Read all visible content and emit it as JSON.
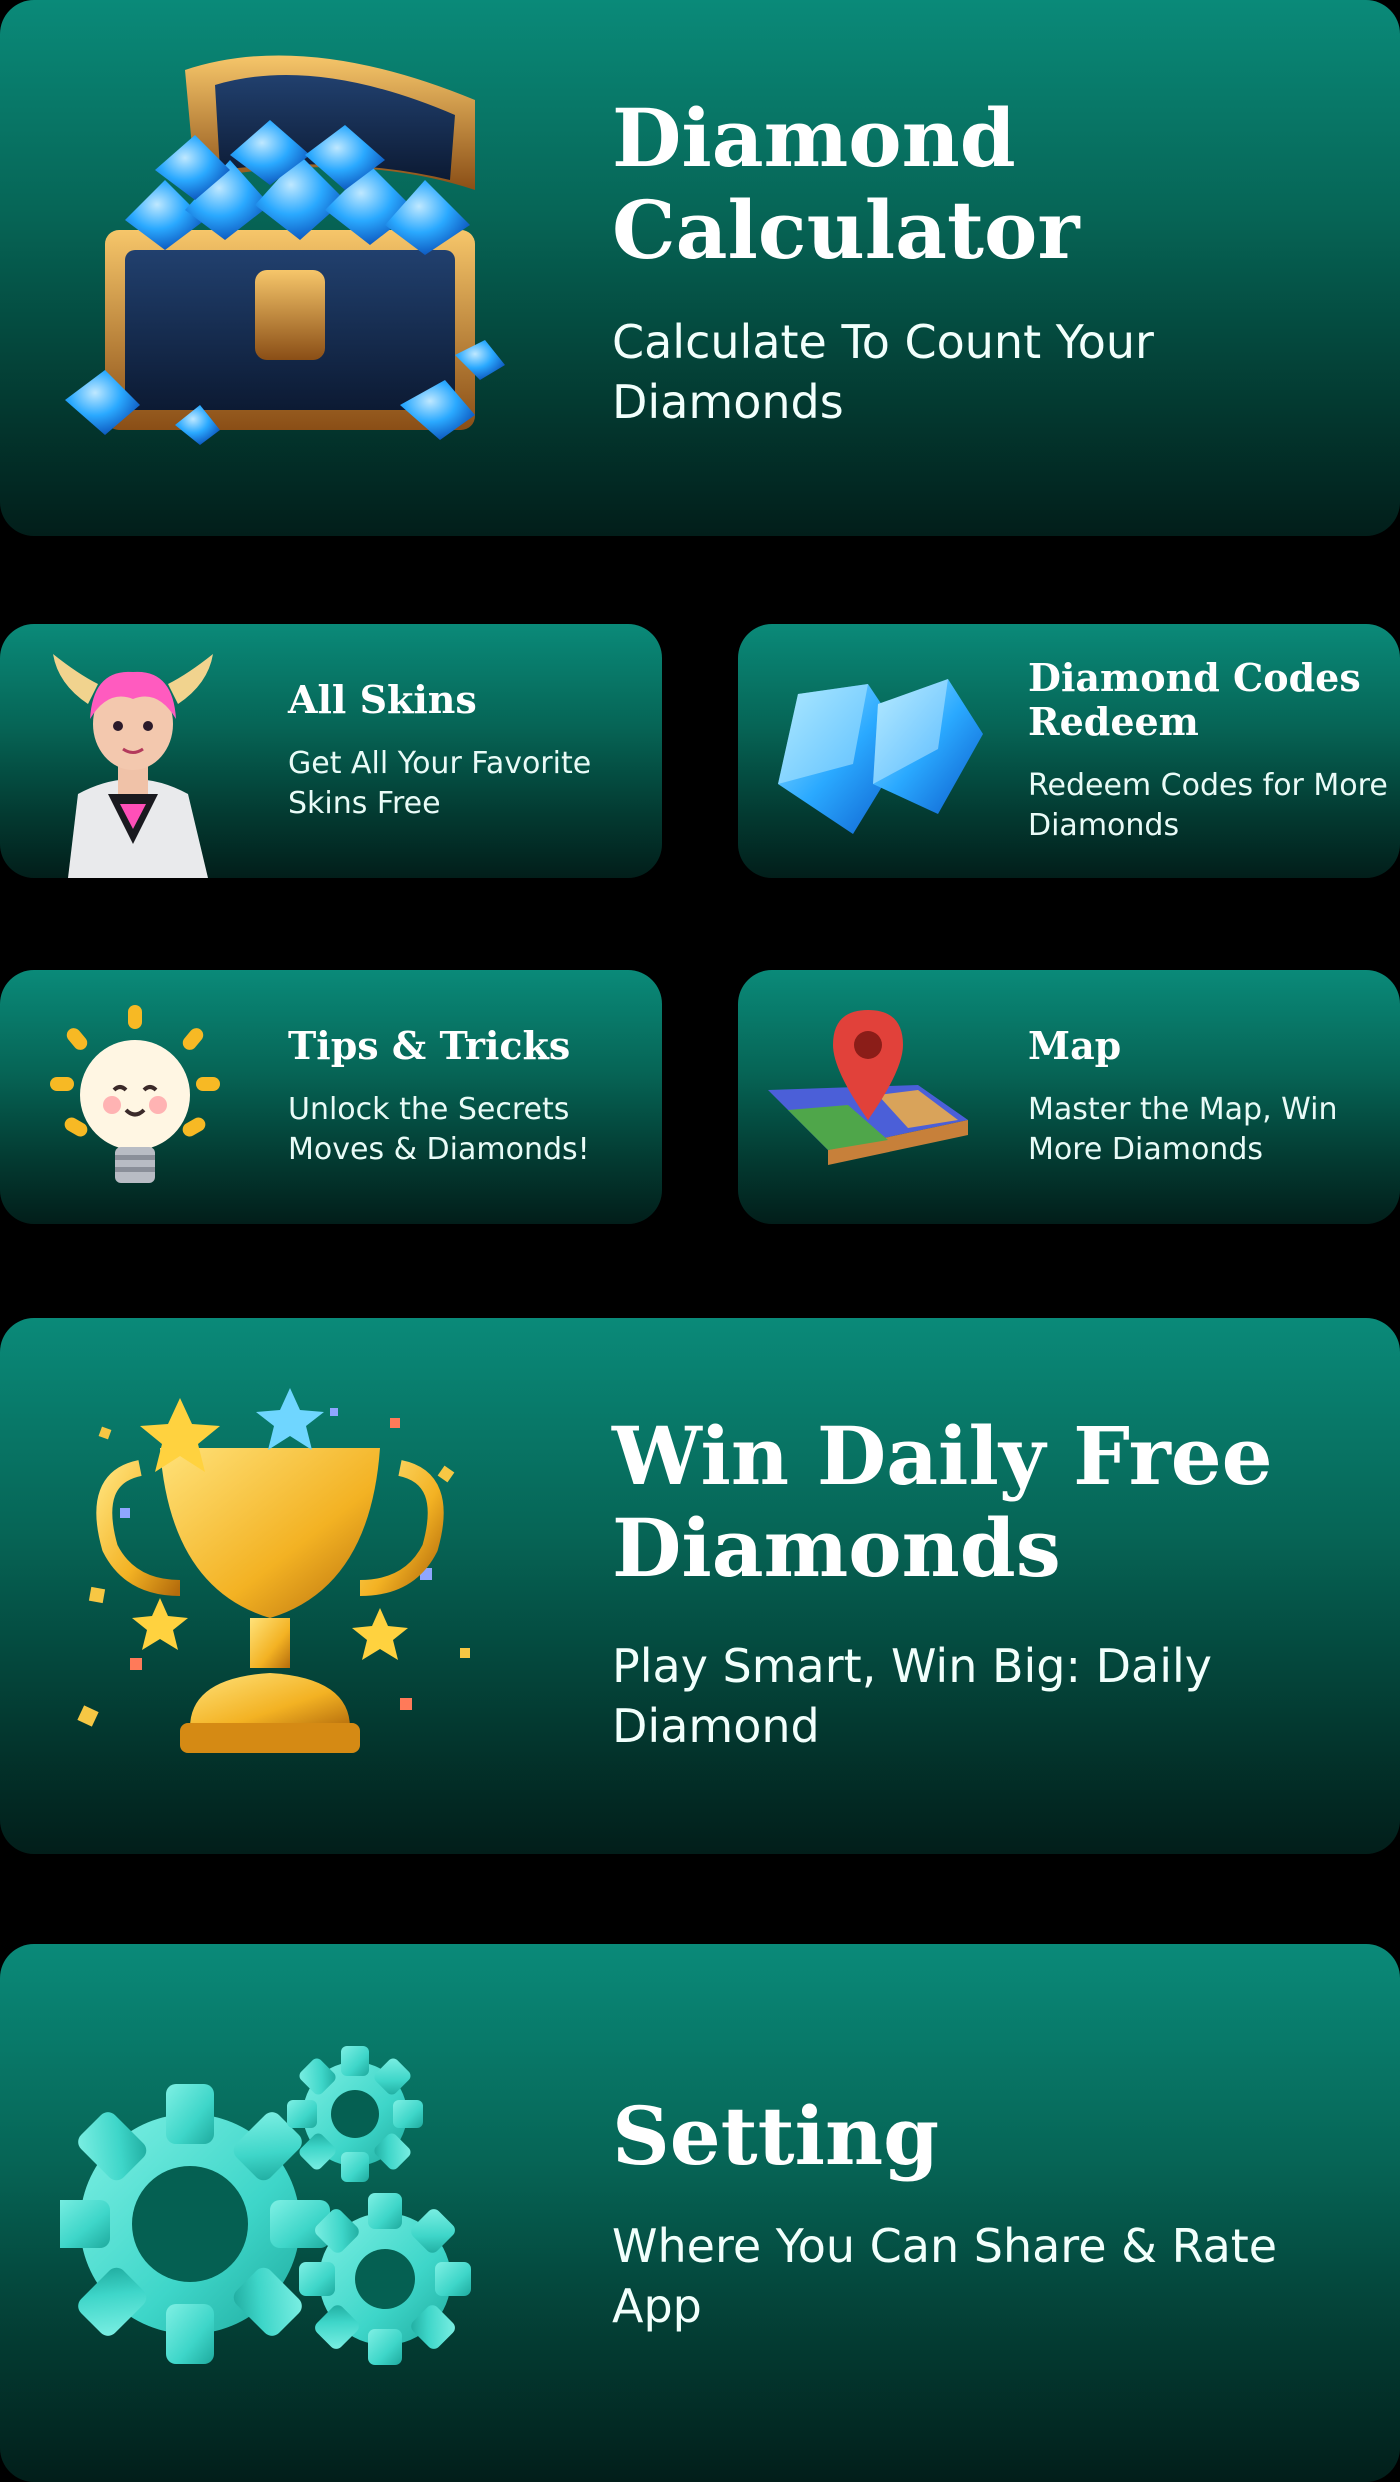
{
  "cards": {
    "calculator": {
      "title": "Diamond Calculator",
      "subtitle": "Calculate To Count Your Diamonds",
      "icon": "treasure-chest-icon"
    },
    "skins": {
      "title": "All Skins",
      "subtitle": "Get All Your Favorite Skins Free",
      "icon": "hero-character-icon"
    },
    "codes": {
      "title": "Diamond Codes Redeem",
      "subtitle": "Redeem Codes for More Diamonds",
      "icon": "blue-diamonds-icon"
    },
    "tips": {
      "title": "Tips & Tricks",
      "subtitle": "Unlock the Secrets Moves & Diamonds!",
      "icon": "lightbulb-icon"
    },
    "map": {
      "title": "Map",
      "subtitle": "Master the Map, Win More Diamonds",
      "icon": "map-pin-icon"
    },
    "daily": {
      "title": "Win Daily Free Diamonds",
      "subtitle": "Play Smart, Win Big: Daily Diamond",
      "icon": "trophy-icon"
    },
    "setting": {
      "title": "Setting",
      "subtitle": "Where You Can Share & Rate App",
      "icon": "gear-icon"
    }
  },
  "colors": {
    "card_top": "#0a8a79",
    "card_bottom": "#021e1a",
    "diamond_blue": "#2aa9ff",
    "gear_teal": "#3ed6c9",
    "trophy_gold": "#f3b223"
  }
}
